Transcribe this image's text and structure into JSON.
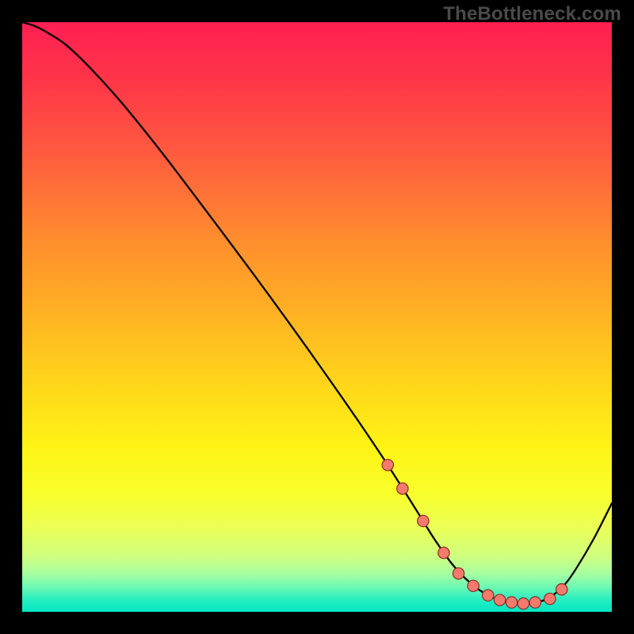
{
  "watermark": "TheBottleneck.com",
  "chart_data": {
    "type": "line",
    "title": "",
    "xlabel": "",
    "ylabel": "",
    "xlim": [
      0,
      100
    ],
    "ylim": [
      0,
      100
    ],
    "grid": false,
    "legend": false,
    "series": [
      {
        "name": "bottleneck-curve",
        "x": [
          0,
          2,
          4,
          7,
          10,
          14,
          18,
          24,
          30,
          36,
          42,
          48,
          54,
          58,
          62,
          66,
          68,
          70,
          73,
          76,
          79,
          82,
          85,
          88,
          90,
          92,
          94,
          97,
          100
        ],
        "y": [
          100,
          99.4,
          98.4,
          96.5,
          93.8,
          89.6,
          85.0,
          77.5,
          69.6,
          61.6,
          53.5,
          45.2,
          36.7,
          30.9,
          24.9,
          18.6,
          15.4,
          12.2,
          8.0,
          4.9,
          2.8,
          1.7,
          1.4,
          1.8,
          2.8,
          4.6,
          7.4,
          12.5,
          18.4
        ]
      }
    ],
    "markers": {
      "name": "highlight-dots",
      "x": [
        62.0,
        64.5,
        68.0,
        71.5,
        74.0,
        76.5,
        79.0,
        81.0,
        83.0,
        85.0,
        87.0,
        89.5,
        91.5
      ],
      "y": [
        24.9,
        20.9,
        15.4,
        10.0,
        6.5,
        4.4,
        2.8,
        2.0,
        1.6,
        1.4,
        1.6,
        2.2,
        3.8
      ]
    },
    "background_gradient": {
      "stops": [
        {
          "pct": 0,
          "color": "#ff1f52"
        },
        {
          "pct": 9,
          "color": "#ff3349"
        },
        {
          "pct": 22,
          "color": "#ff5a3f"
        },
        {
          "pct": 36,
          "color": "#ff8a2e"
        },
        {
          "pct": 50,
          "color": "#ffb423"
        },
        {
          "pct": 62,
          "color": "#ffd81a"
        },
        {
          "pct": 72,
          "color": "#fff315"
        },
        {
          "pct": 80,
          "color": "#f9ff2b"
        },
        {
          "pct": 86,
          "color": "#eaff58"
        },
        {
          "pct": 90.5,
          "color": "#cfff7e"
        },
        {
          "pct": 93.5,
          "color": "#a8ffa0"
        },
        {
          "pct": 96,
          "color": "#66f7b5"
        },
        {
          "pct": 98,
          "color": "#26eec1"
        },
        {
          "pct": 100,
          "color": "#00e6c3"
        }
      ]
    },
    "marker_color": "#f47a6e",
    "curve_color": "#000000"
  }
}
